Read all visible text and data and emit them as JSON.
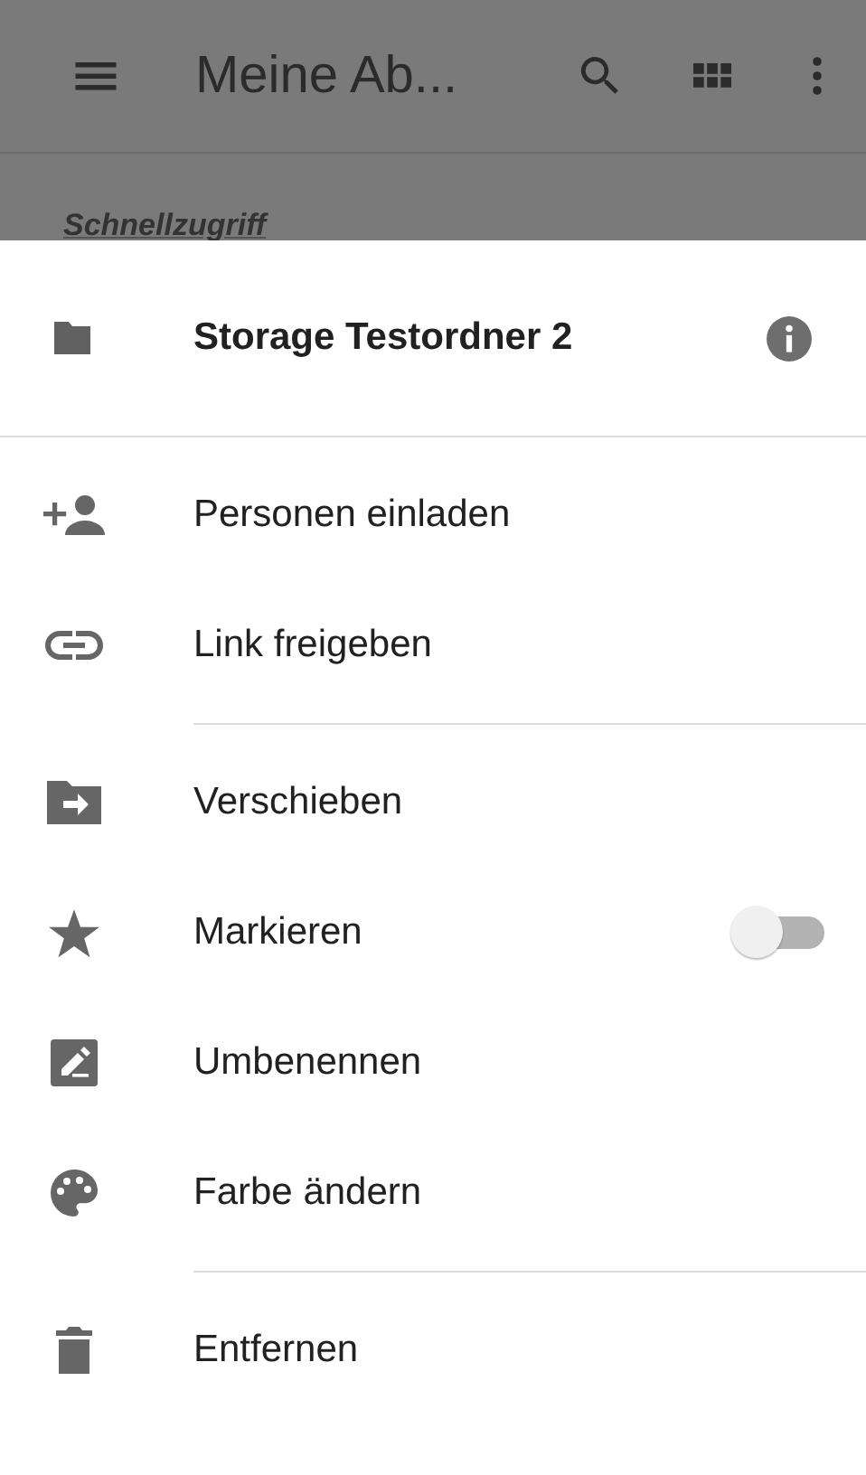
{
  "app_bar": {
    "title": "Meine Ab..."
  },
  "quick_access": {
    "label": "Schnellzugriff"
  },
  "sheet": {
    "header": {
      "title": "Storage Testordner 2"
    },
    "groups": [
      {
        "items": [
          {
            "kind": "action",
            "label": "Personen einladen"
          },
          {
            "kind": "action",
            "label": "Link freigeben"
          }
        ]
      },
      {
        "items": [
          {
            "kind": "action",
            "label": "Verschieben"
          },
          {
            "kind": "toggle",
            "label": "Markieren",
            "on": false
          },
          {
            "kind": "action",
            "label": "Umbenennen"
          },
          {
            "kind": "action",
            "label": "Farbe ändern"
          }
        ]
      },
      {
        "items": [
          {
            "kind": "action",
            "label": "Entfernen"
          }
        ]
      }
    ]
  }
}
